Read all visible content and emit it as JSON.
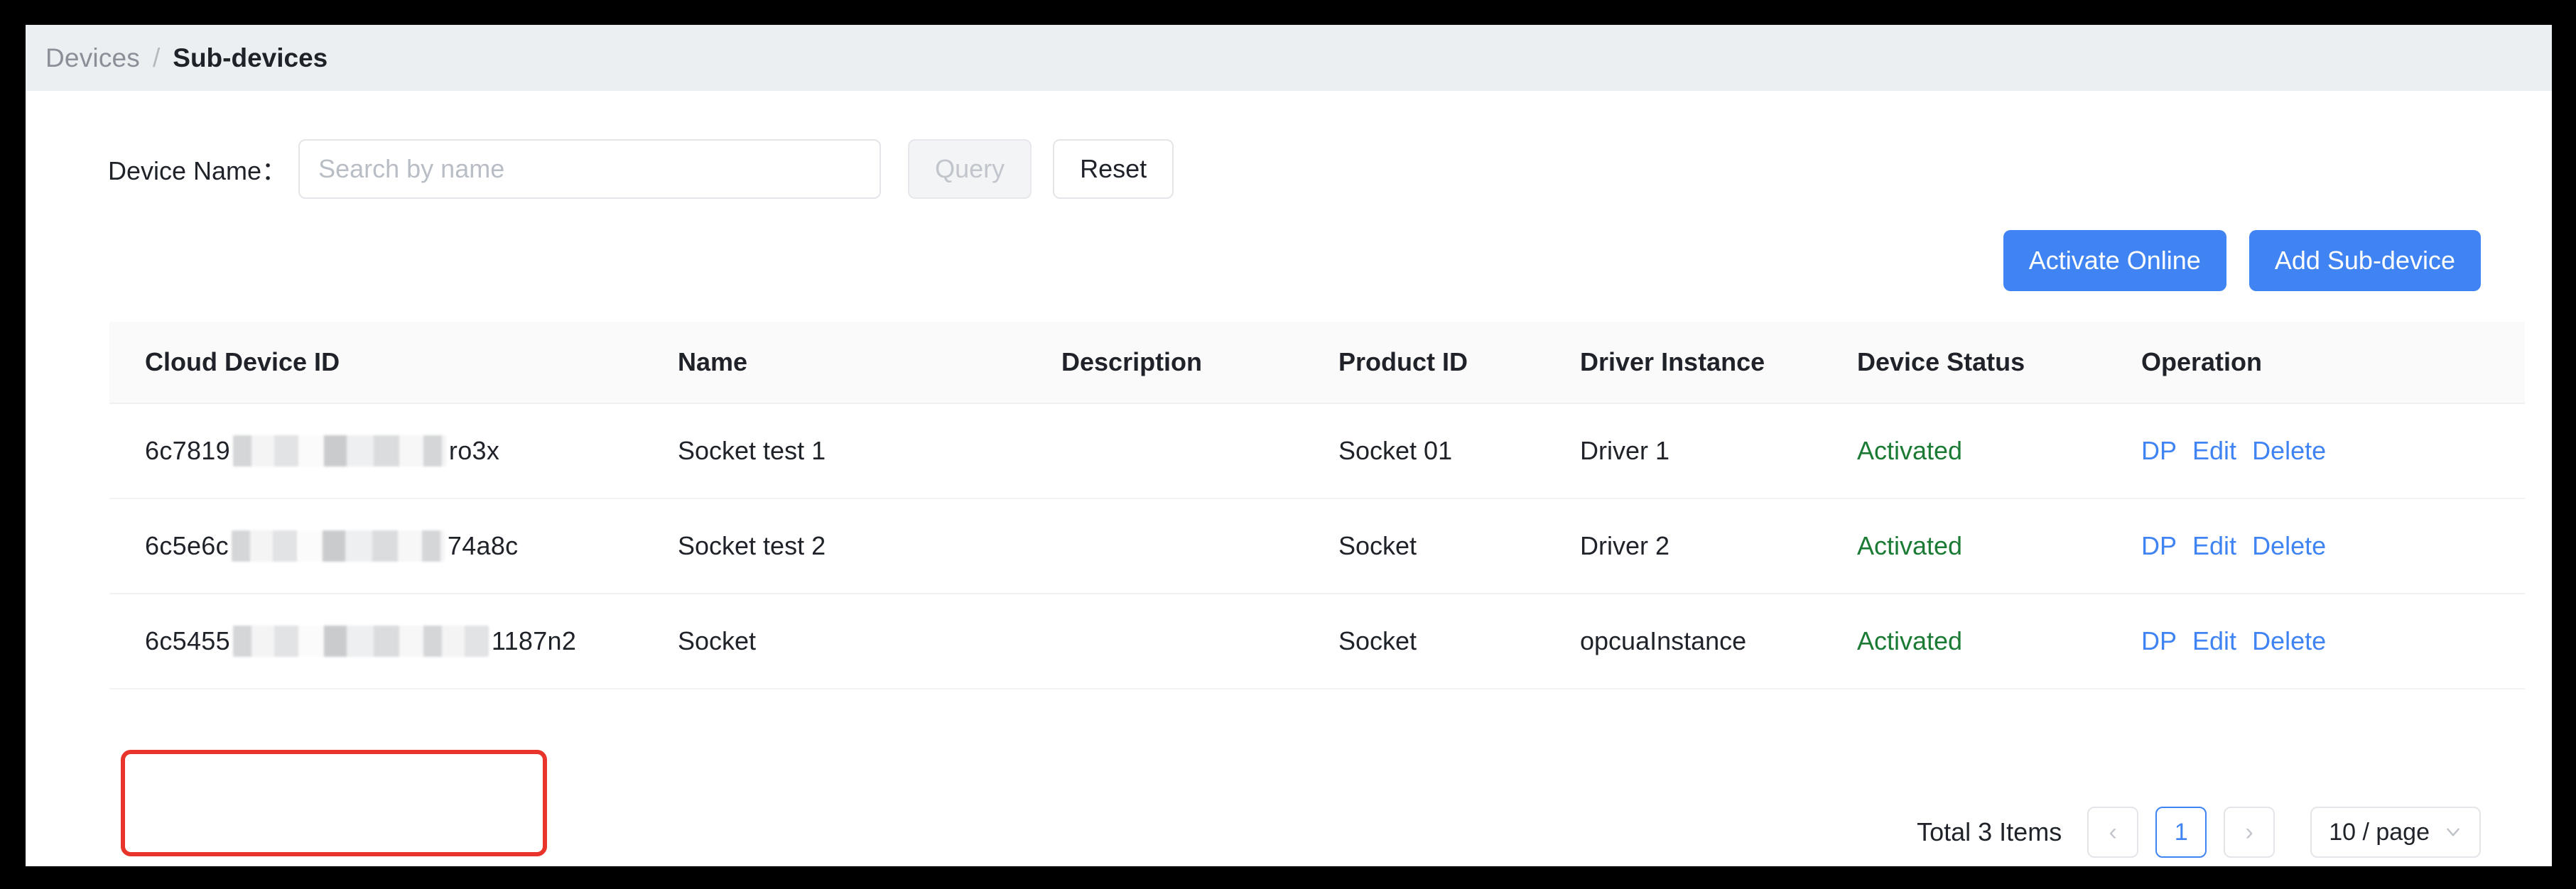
{
  "breadcrumb": {
    "parent": "Devices",
    "separator": "/",
    "current": "Sub-devices"
  },
  "filter": {
    "device_name_label": "Device Name：",
    "search_placeholder": "Search by name",
    "search_value": "",
    "query_label": "Query",
    "query_disabled": true,
    "reset_label": "Reset"
  },
  "actions": {
    "activate_online_label": "Activate Online",
    "add_subdevice_label": "Add Sub-device",
    "primary_color": "#3f84f2"
  },
  "table": {
    "columns": [
      "Cloud Device ID",
      "Name",
      "Description",
      "Product ID",
      "Driver Instance",
      "Device Status",
      "Operation"
    ],
    "rows": [
      {
        "id_prefix": "6c7819",
        "id_suffix": "ro3x",
        "name": "Socket test 1",
        "description": "",
        "product_id": "Socket 01",
        "driver_instance": "Driver 1",
        "device_status": "Activated",
        "operations": [
          "DP",
          "Edit",
          "Delete"
        ]
      },
      {
        "id_prefix": "6c5e6c",
        "id_suffix": "74a8c",
        "name": "Socket test 2",
        "description": "",
        "product_id": "Socket",
        "driver_instance": "Driver 2",
        "device_status": "Activated",
        "operations": [
          "DP",
          "Edit",
          "Delete"
        ]
      },
      {
        "id_prefix": "6c5455",
        "id_suffix": "1187n2",
        "name": "Socket",
        "description": "",
        "product_id": "Socket",
        "driver_instance": "opcuaInstance",
        "device_status": "Activated",
        "operations": [
          "DP",
          "Edit",
          "Delete"
        ]
      }
    ],
    "status_color": "#1b7a34",
    "link_color": "#3f84f2"
  },
  "highlight": {
    "color": "#e8342a",
    "target": "row-3-cloud-device-id"
  },
  "pagination": {
    "total_label": "Total 3 Items",
    "prev_icon": "‹",
    "next_icon": "›",
    "current_page": "1",
    "page_size_label": "10 / page",
    "chevron_icon": "chevron-down-icon"
  }
}
